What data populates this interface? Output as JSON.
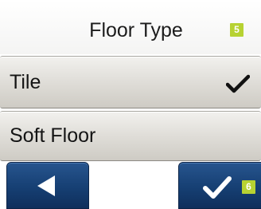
{
  "header": {
    "title": "Floor Type",
    "step_badge": "5"
  },
  "options": [
    {
      "label": "Tile",
      "selected": true
    },
    {
      "label": "Soft Floor",
      "selected": false
    }
  ],
  "footer": {
    "back_icon": "triangle-left-icon",
    "confirm_icon": "checkmark-icon",
    "next_step_badge": "6"
  },
  "colors": {
    "accent_badge": "#b7d232",
    "nav_button": "#1a4580",
    "option_bg": "#e1dfda"
  }
}
